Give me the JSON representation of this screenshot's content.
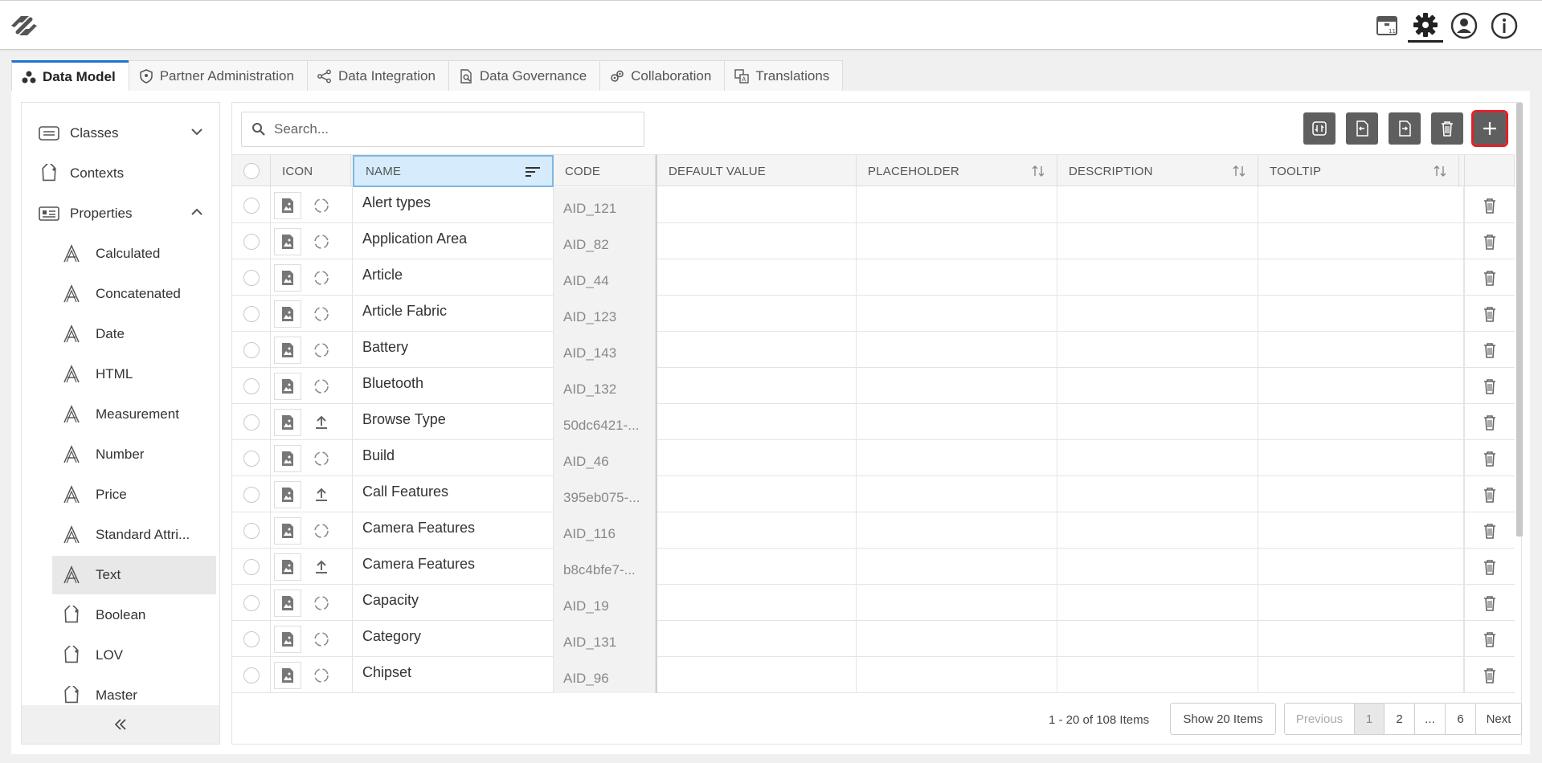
{
  "header": {
    "icons": [
      "app-logo",
      "calendar-icon",
      "settings-icon",
      "user-account-icon",
      "info-icon"
    ],
    "active_icon": "settings-icon"
  },
  "tabs": [
    {
      "label": "Data Model",
      "icon": "data-model-icon",
      "active": true
    },
    {
      "label": "Partner Administration",
      "icon": "shield-icon",
      "active": false
    },
    {
      "label": "Data Integration",
      "icon": "integration-icon",
      "active": false
    },
    {
      "label": "Data Governance",
      "icon": "governance-icon",
      "active": false
    },
    {
      "label": "Collaboration",
      "icon": "collaboration-icon",
      "active": false
    },
    {
      "label": "Translations",
      "icon": "translations-icon",
      "active": false
    }
  ],
  "sidebar": {
    "items": [
      {
        "label": "Classes",
        "icon": "classes-icon",
        "expandable": "collapsed"
      },
      {
        "label": "Contexts",
        "icon": "tag-icon"
      },
      {
        "label": "Properties",
        "icon": "properties-icon",
        "expandable": "expanded"
      }
    ],
    "sub_items": [
      {
        "label": "Calculated",
        "icon": "attribute-icon"
      },
      {
        "label": "Concatenated",
        "icon": "attribute-icon"
      },
      {
        "label": "Date",
        "icon": "attribute-icon"
      },
      {
        "label": "HTML",
        "icon": "attribute-icon"
      },
      {
        "label": "Measurement",
        "icon": "attribute-icon"
      },
      {
        "label": "Number",
        "icon": "attribute-icon"
      },
      {
        "label": "Price",
        "icon": "attribute-icon"
      },
      {
        "label": "Standard Attri...",
        "icon": "attribute-icon"
      },
      {
        "label": "Text",
        "icon": "attribute-icon",
        "selected": true
      },
      {
        "label": "Boolean",
        "icon": "tag-icon"
      },
      {
        "label": "LOV",
        "icon": "tag-icon"
      },
      {
        "label": "Master",
        "icon": "tag-icon"
      }
    ],
    "collapse_icon": "double-chevron-left-icon"
  },
  "toolbar": {
    "search_placeholder": "Search...",
    "buttons": [
      "refresh-button",
      "import-button",
      "export-button",
      "delete-button",
      "add-button"
    ]
  },
  "grid": {
    "columns": [
      "ICON",
      "NAME",
      "CODE",
      "DEFAULT VALUE",
      "PLACEHOLDER",
      "DESCRIPTION",
      "TOOLTIP"
    ],
    "sorted_column": "NAME",
    "rows": [
      {
        "name": "Alert types",
        "code": "AID_121",
        "status": "sync"
      },
      {
        "name": "Application Area",
        "code": "AID_82",
        "status": "sync"
      },
      {
        "name": "Article",
        "code": "AID_44",
        "status": "sync"
      },
      {
        "name": "Article Fabric",
        "code": "AID_123",
        "status": "sync"
      },
      {
        "name": "Battery",
        "code": "AID_143",
        "status": "sync"
      },
      {
        "name": "Bluetooth",
        "code": "AID_132",
        "status": "sync"
      },
      {
        "name": "Browse Type",
        "code": "50dc6421-...",
        "status": "upload"
      },
      {
        "name": "Build",
        "code": "AID_46",
        "status": "sync"
      },
      {
        "name": "Call Features",
        "code": "395eb075-...",
        "status": "upload"
      },
      {
        "name": "Camera Features",
        "code": "AID_116",
        "status": "sync"
      },
      {
        "name": "Camera Features",
        "code": "b8c4bfe7-...",
        "status": "upload"
      },
      {
        "name": "Capacity",
        "code": "AID_19",
        "status": "sync"
      },
      {
        "name": "Category",
        "code": "AID_131",
        "status": "sync"
      },
      {
        "name": "Chipset",
        "code": "AID_96",
        "status": "sync"
      }
    ]
  },
  "footer": {
    "items_count": "1 - 20 of 108 Items",
    "show_items": "Show 20 Items",
    "pagination": [
      "Previous",
      "1",
      "2",
      "...",
      "6",
      "Next"
    ],
    "current_page": "1"
  },
  "colors": {
    "accent_tab": "#1e73d8",
    "add_button_outline": "#e0202a",
    "toolbar_button": "#5f5f5f",
    "sorted_header": "#d6ebfb"
  }
}
